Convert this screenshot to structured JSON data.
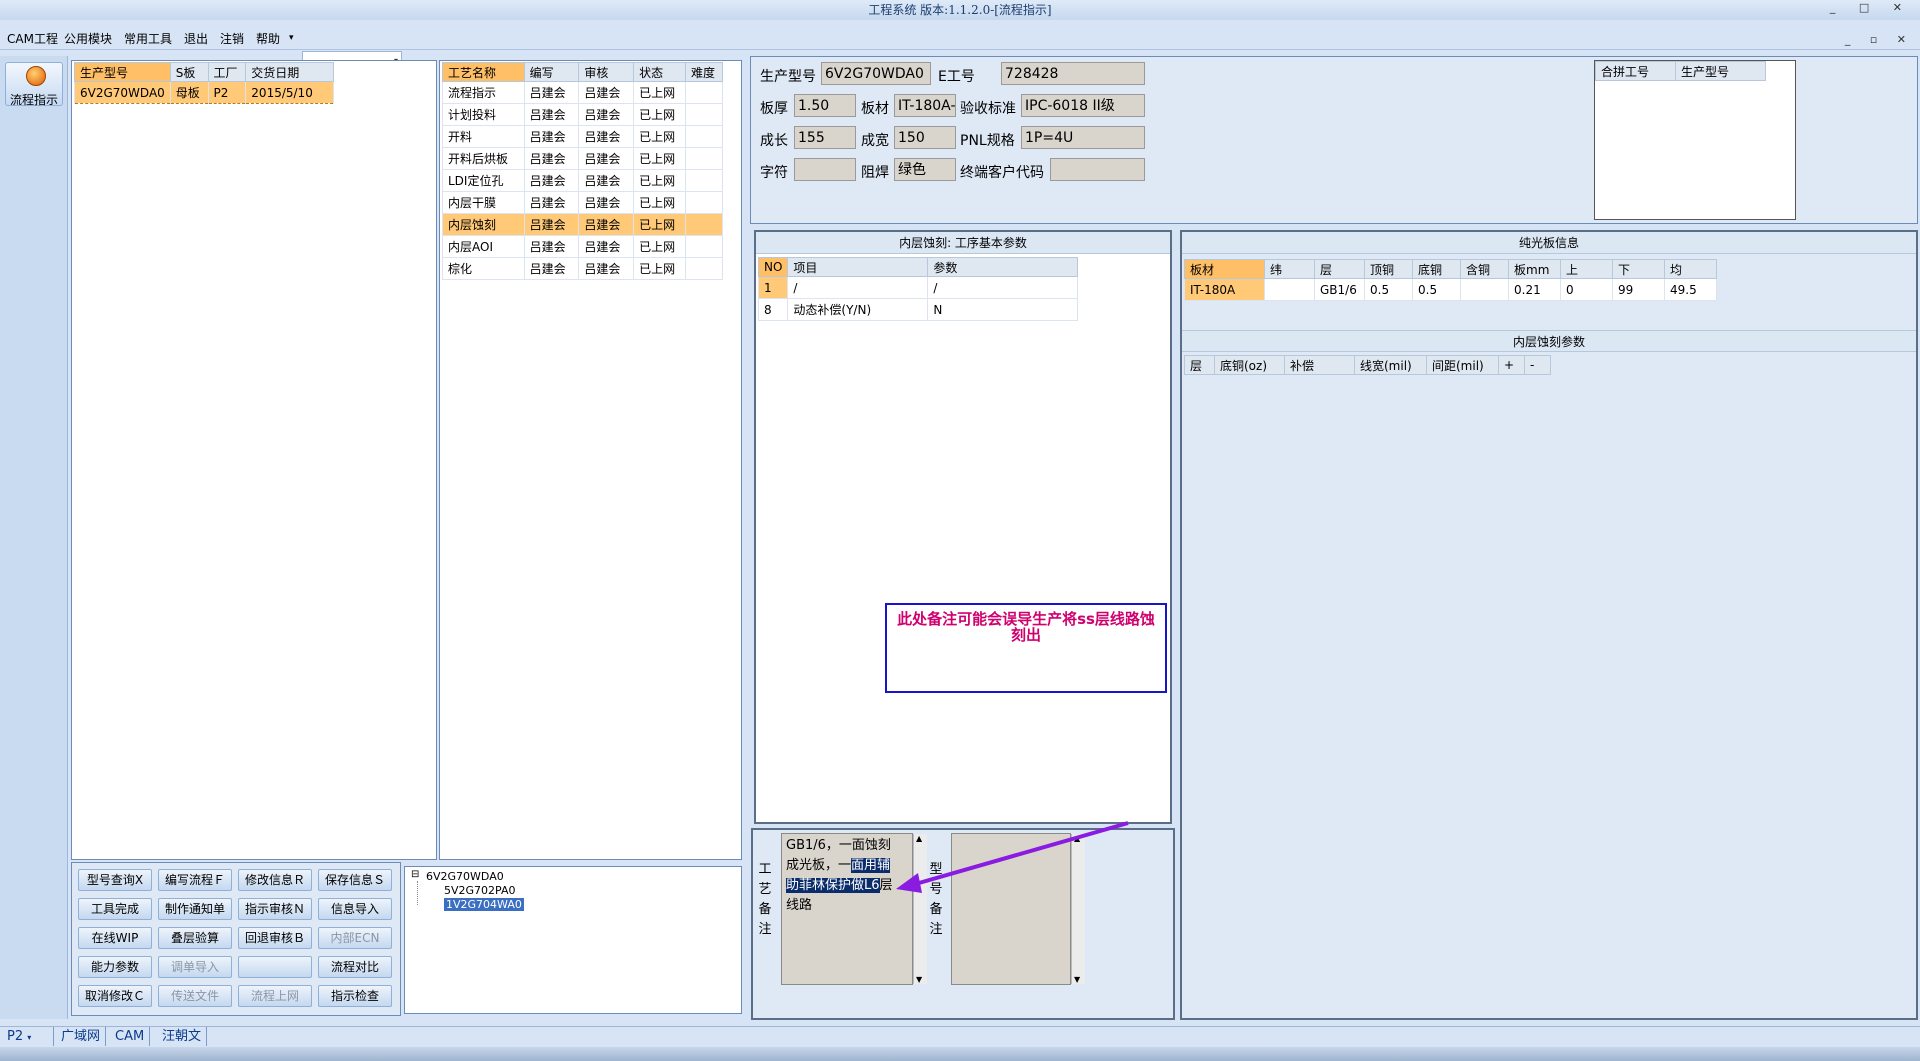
{
  "title": "工程系统 版本:1.1.2.0-[流程指示]",
  "window_controls": "_ □ ✕",
  "mdi_controls": "_ ▫ ✕",
  "menu": [
    "CAM工程",
    "公用模块",
    "常用工具",
    "退出",
    "注销",
    "帮助"
  ],
  "help_arrow": "▾",
  "combo_value": "",
  "left_nav": {
    "label": "流程指示"
  },
  "orders": {
    "headers": [
      "生产型号",
      "S板",
      "工厂",
      "交货日期"
    ],
    "rows": [
      [
        "6V2G70WDA0",
        "母板",
        "P2",
        "2015/5/10"
      ]
    ]
  },
  "process": {
    "headers": [
      "工艺名称",
      "编写",
      "审核",
      "状态",
      "难度"
    ],
    "rows": [
      [
        "流程指示",
        "吕建会",
        "吕建会",
        "已上网",
        ""
      ],
      [
        "计划投料",
        "吕建会",
        "吕建会",
        "已上网",
        ""
      ],
      [
        "开料",
        "吕建会",
        "吕建会",
        "已上网",
        ""
      ],
      [
        "开料后烘板",
        "吕建会",
        "吕建会",
        "已上网",
        ""
      ],
      [
        "LDI定位孔",
        "吕建会",
        "吕建会",
        "已上网",
        ""
      ],
      [
        "内层干膜",
        "吕建会",
        "吕建会",
        "已上网",
        ""
      ],
      [
        "内层蚀刻",
        "吕建会",
        "吕建会",
        "已上网",
        ""
      ],
      [
        "内层AOI",
        "吕建会",
        "吕建会",
        "已上网",
        ""
      ],
      [
        "棕化",
        "吕建会",
        "吕建会",
        "已上网",
        ""
      ]
    ],
    "selected": 6
  },
  "info": {
    "prod_model_label": "生产型号",
    "prod_model": "6V2G70WDA0",
    "e_no_label": "E工号",
    "e_no": "728428",
    "thick_label": "板厚",
    "thick": "1.50",
    "material_label": "板材",
    "material": "IT-180A-",
    "accept_label": "验收标准",
    "accept": "IPC-6018 II级",
    "len_label": "成长",
    "len": "155",
    "wid_label": "成宽",
    "wid": "150",
    "pnl_label": "PNL规格",
    "pnl": "1P=4U",
    "char_label": "字符",
    "char": "",
    "mask_label": "阻焊",
    "mask": "绿色",
    "cust_label": "终端客户代码",
    "cust": ""
  },
  "combo_table": {
    "headers": [
      "合拼工号",
      "生产型号"
    ]
  },
  "etch_params": {
    "title": "内层蚀刻: 工序基本参数",
    "headers": [
      "NO",
      "项目",
      "参数"
    ],
    "rows": [
      [
        "1",
        "/",
        "/"
      ],
      [
        "8",
        "动态补偿(Y/N)",
        "N"
      ]
    ]
  },
  "bare_board": {
    "title": "纯光板信息",
    "headers": [
      "板材",
      "纬",
      "层",
      "顶铜",
      "底铜",
      "含铜",
      "板mm",
      "上",
      "下",
      "均"
    ],
    "rows": [
      [
        "IT-180A",
        "",
        "GB1/6",
        "0.5",
        "0.5",
        "",
        "0.21",
        "0",
        "99",
        "49.5"
      ]
    ]
  },
  "inner_etch": {
    "title": "内层蚀刻参数",
    "headers": [
      "层",
      "底铜(oz)",
      "补偿",
      "线宽(mil)",
      "间距(mil)",
      "+",
      "-"
    ]
  },
  "annotation": "此处备注可能会误导生产将ss层线路蚀刻出",
  "memo": {
    "label": "工艺备注",
    "text_plain_1": "GB1/6，一面蚀刻",
    "text_plain_2": "成光板，一",
    "text_hl_2": "面用辅",
    "text_hl_3a": "助菲林保护做L6",
    "text_plain_3": "层",
    "text_plain_4": "线路"
  },
  "memo2_label": "型号备注",
  "scroll_up": "▲",
  "scroll_down": "▼",
  "tree": {
    "root": "6V2G70WDA0",
    "children": [
      "5V2G702PA0",
      "1V2G704WA0"
    ],
    "selected": 1,
    "expander": "⊟"
  },
  "buttons": [
    [
      "型号查询Ⅹ",
      "编写流程Ｆ",
      "修改信息Ｒ",
      "保存信息Ｓ"
    ],
    [
      "工具完成",
      "制作通知单",
      "指示审核Ｎ",
      "信息导入"
    ],
    [
      "在线WIP",
      "叠层验算",
      "回退审核Ｂ",
      "内部ECN"
    ],
    [
      "能力参数",
      "调单导入",
      "",
      "流程对比"
    ],
    [
      "取消修改Ｃ",
      "传送文件",
      "流程上网",
      "指示检查"
    ]
  ],
  "disabled_buttons": [
    "内部ECN",
    "调单导入",
    "传送文件",
    "流程上网"
  ],
  "status_tabs": {
    "factory": "P2",
    "factory_arrow": "▾",
    "items": [
      "广域网",
      "CAM",
      "汪朝文"
    ]
  },
  "colors": {
    "accent": "#ffbf66",
    "note_text": "#d0006f",
    "note_border": "#1616c8",
    "arrow": "#8a1be0"
  }
}
